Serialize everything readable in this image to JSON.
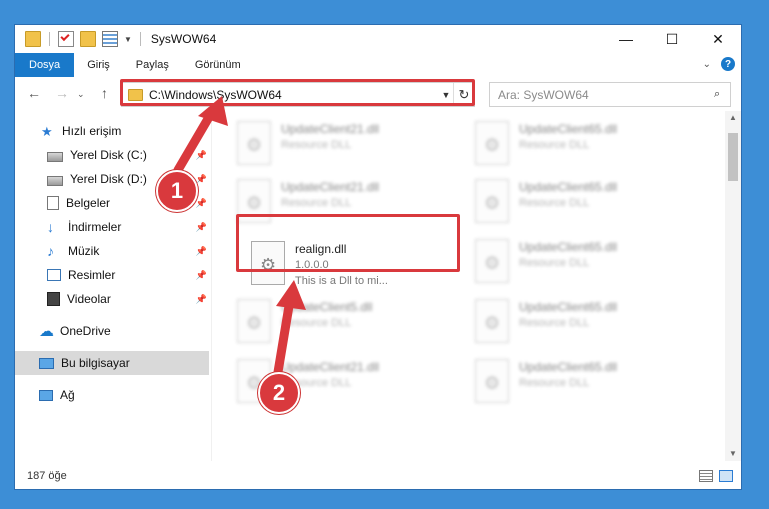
{
  "window": {
    "title": "SysWOW64"
  },
  "ribbon": {
    "tabs": [
      "Dosya",
      "Giriş",
      "Paylaş",
      "Görünüm"
    ],
    "help": "?"
  },
  "controls": {
    "minimize": "—",
    "maximize": "☐",
    "close": "✕"
  },
  "nav": {
    "back": "←",
    "forward": "→",
    "up": "↑"
  },
  "address": {
    "path": "C:\\Windows\\SysWOW64",
    "refresh": "↻"
  },
  "search": {
    "placeholder": "Ara: SysWOW64"
  },
  "sidebar": {
    "items": [
      {
        "label": "Hızlı erişim"
      },
      {
        "label": "Yerel Disk (C:)"
      },
      {
        "label": "Yerel Disk (D:)"
      },
      {
        "label": "Belgeler"
      },
      {
        "label": "İndirmeler"
      },
      {
        "label": "Müzik"
      },
      {
        "label": "Resimler"
      },
      {
        "label": "Videolar"
      },
      {
        "label": "OneDrive"
      },
      {
        "label": "Bu bilgisayar"
      },
      {
        "label": "Ağ"
      }
    ]
  },
  "files": [
    {
      "name": "UpdateClient21.dll",
      "sub": "Resource DLL"
    },
    {
      "name": "UpdateClient65.dll",
      "sub": "Resource DLL"
    },
    {
      "name": "UpdateClient21.dll",
      "sub": "Resource DLL"
    },
    {
      "name": "UpdateClient65.dll",
      "sub": "Resource DLL"
    },
    {
      "name": "realign.dll",
      "sub": "1.0.0.0",
      "desc": "This is a Dll to mi..."
    },
    {
      "name": "UpdateClient65.dll",
      "sub": "Resource DLL"
    },
    {
      "name": "UpdateClient5.dll",
      "sub": "Resource DLL"
    },
    {
      "name": "UpdateClient65.dll",
      "sub": "Resource DLL"
    },
    {
      "name": "UpdateClient21.dll",
      "sub": "Resource DLL"
    },
    {
      "name": "UpdateClient65.dll",
      "sub": "Resource DLL"
    }
  ],
  "status": {
    "count": "187 öğe"
  },
  "annotations": {
    "step1": "1",
    "step2": "2",
    "color": "#d9393d"
  }
}
